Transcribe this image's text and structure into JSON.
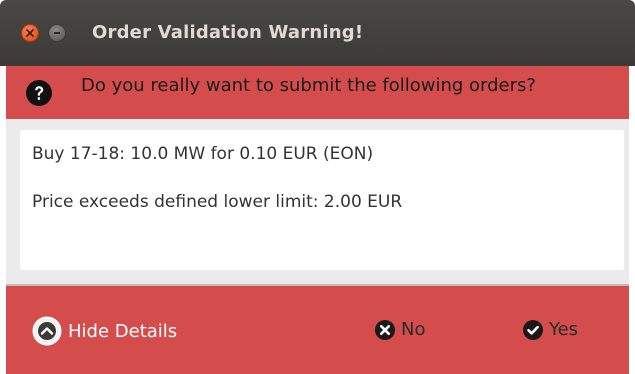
{
  "window": {
    "title": "Order Validation Warning!",
    "controls": [
      "close-icon",
      "minimize-icon"
    ]
  },
  "question": {
    "icon": "question-circle-icon",
    "text": "Do you really want to submit the following orders?"
  },
  "details": {
    "lines": [
      "Buy 17-18: 10.0 MW for 0.10 EUR (EON)",
      "Price exceeds defined lower limit: 2.00 EUR"
    ]
  },
  "footer": {
    "hide_details": {
      "label": "Hide Details",
      "icon": "chevron-up-circle-icon"
    },
    "no": {
      "label": "No",
      "icon": "x-circle-icon"
    },
    "yes": {
      "label": "Yes",
      "icon": "check-circle-icon"
    }
  },
  "colors": {
    "titlebar": "#3b3a37",
    "accent_red": "#d44c4c",
    "close_orange": "#e5561f"
  }
}
